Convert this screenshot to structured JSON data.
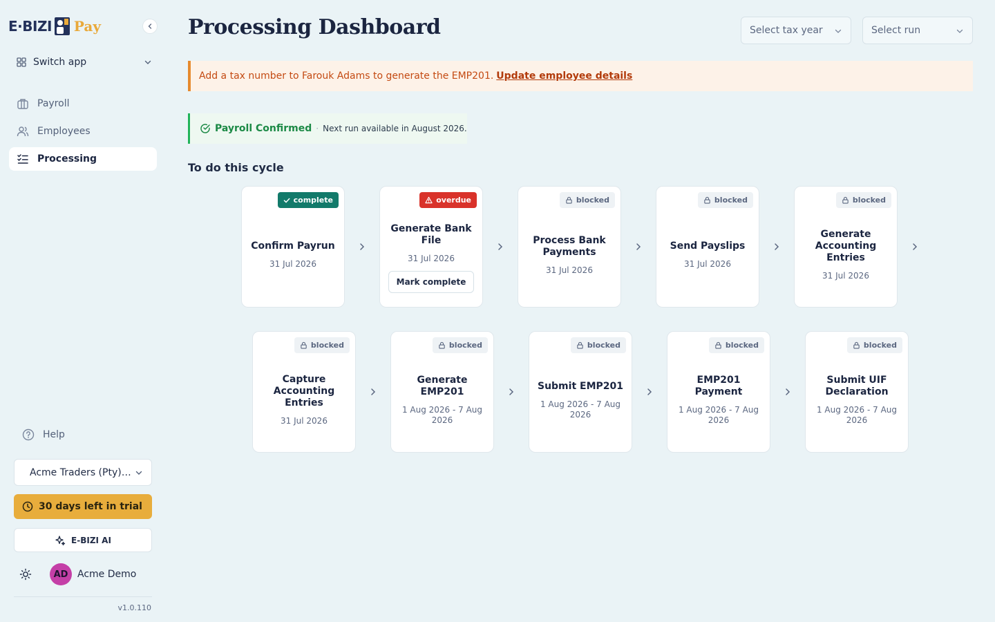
{
  "brand": {
    "name_left": "E·BIZI",
    "name_right": "Pay",
    "accent": "#e9a93a"
  },
  "sidebar": {
    "switch_app": "Switch app",
    "nav": [
      {
        "label": "Payroll",
        "icon": "briefcase-icon",
        "active": false
      },
      {
        "label": "Employees",
        "icon": "users-icon",
        "active": false
      },
      {
        "label": "Processing",
        "icon": "checklist-icon",
        "active": true
      }
    ],
    "help": "Help",
    "company": "Acme Traders (Pty) Ltd",
    "trial": "30 days left in trial",
    "ai": "E-BIZI AI",
    "user": {
      "initials": "AD",
      "name": "Acme Demo"
    },
    "version": "v1.0.110"
  },
  "header": {
    "title": "Processing Dashboard",
    "tax_year_placeholder": "Select tax year",
    "run_placeholder": "Select run"
  },
  "alert": {
    "text": "Add a tax number to Farouk Adams to generate the EMP201.",
    "link": "Update employee details"
  },
  "status": {
    "title": "Payroll Confirmed",
    "separator": "·",
    "detail": "Next run available in August 2026."
  },
  "section_title": "To do this cycle",
  "tasks": [
    {
      "title": "Confirm Payrun",
      "date": "31 Jul 2026",
      "status": "complete"
    },
    {
      "title": "Generate Bank File",
      "date": "31 Jul 2026",
      "status": "overdue",
      "action": "Mark complete"
    },
    {
      "title": "Process Bank Payments",
      "date": "31 Jul 2026",
      "status": "blocked"
    },
    {
      "title": "Send Payslips",
      "date": "31 Jul 2026",
      "status": "blocked"
    },
    {
      "title": "Generate Accounting Entries",
      "date": "31 Jul 2026",
      "status": "blocked"
    },
    {
      "title": "Capture Accounting Entries",
      "date": "31 Jul 2026",
      "status": "blocked"
    },
    {
      "title": "Generate EMP201",
      "date": "1 Aug 2026 - 7 Aug 2026",
      "status": "blocked"
    },
    {
      "title": "Submit EMP201",
      "date": "1 Aug 2026 - 7 Aug 2026",
      "status": "blocked"
    },
    {
      "title": "EMP201 Payment",
      "date": "1 Aug 2026 - 7 Aug 2026",
      "status": "blocked"
    },
    {
      "title": "Submit UIF Declaration",
      "date": "1 Aug 2026 - 7 Aug 2026",
      "status": "blocked"
    }
  ]
}
